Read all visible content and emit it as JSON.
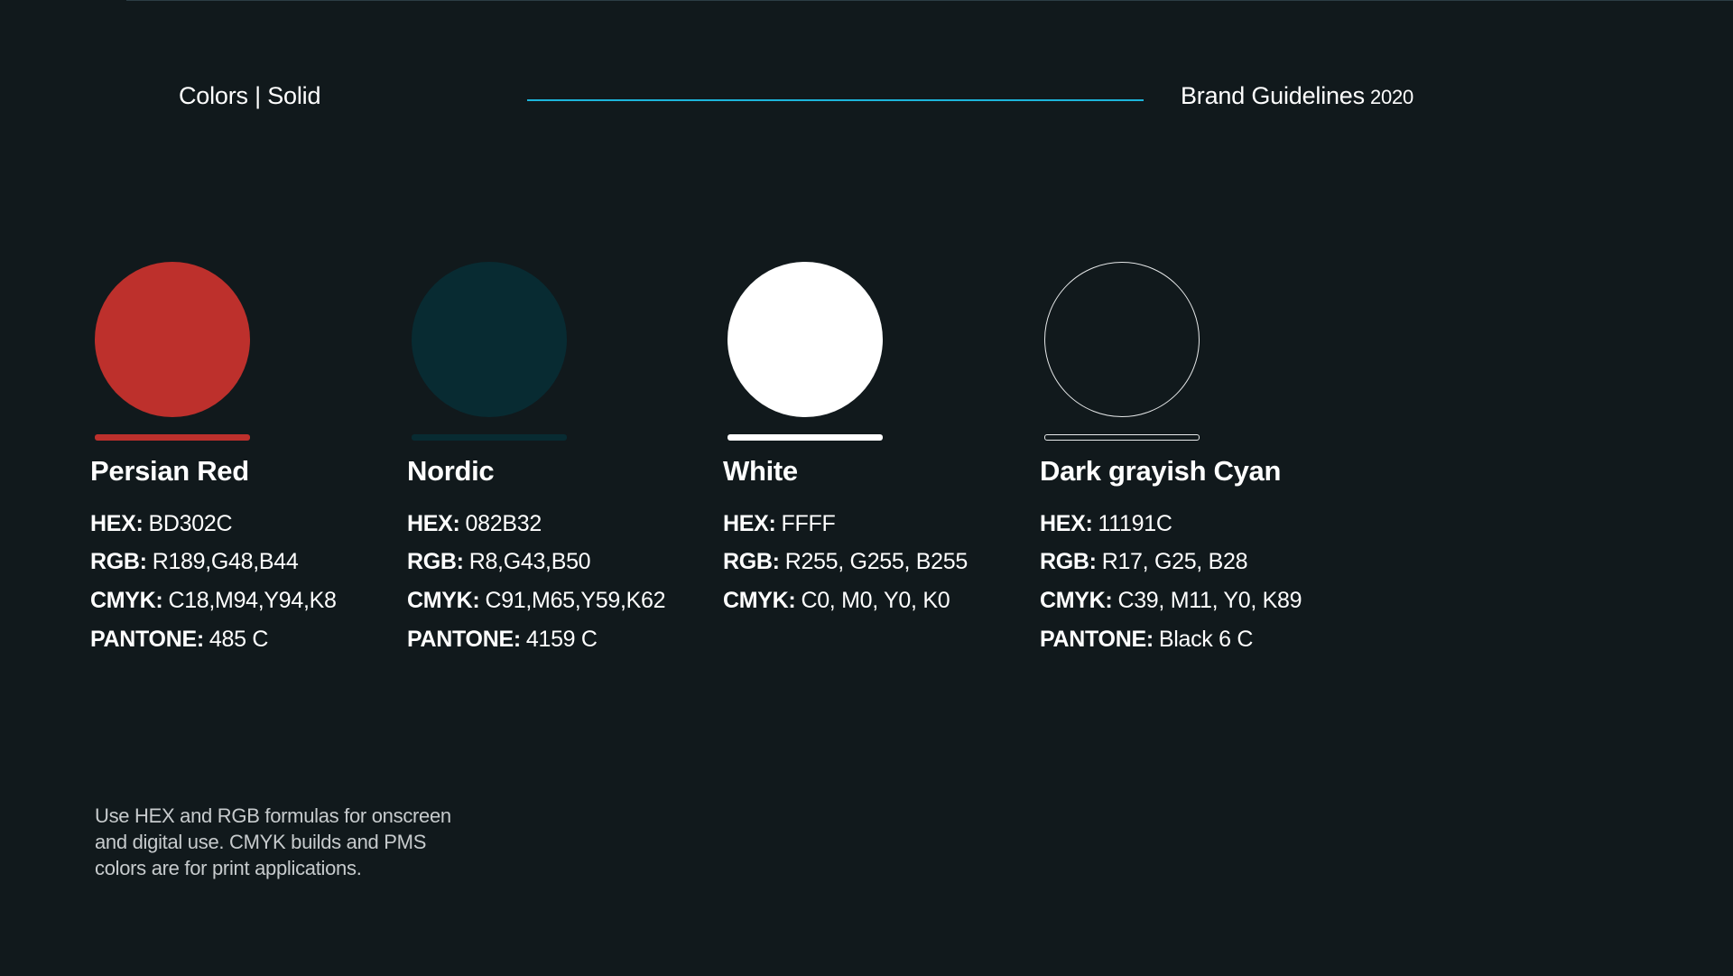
{
  "header": {
    "section_title": "Colors | Solid",
    "brand_title": "Brand Guidelines",
    "brand_year": "2020",
    "rule_color": "#1CB5DA"
  },
  "swatches": [
    {
      "name": "Persian Red",
      "fill": "#BD302C",
      "specs": [
        {
          "label": "HEX:",
          "value": "BD302C"
        },
        {
          "label": "RGB:",
          "value": "R189,G48,B44"
        },
        {
          "label": "CMYK:",
          "value": "C18,M94,Y94,K8"
        },
        {
          "label": "PANTONE:",
          "value": "485 C"
        }
      ]
    },
    {
      "name": "Nordic",
      "fill": "#082B32",
      "specs": [
        {
          "label": "HEX:",
          "value": "082B32"
        },
        {
          "label": "RGB:",
          "value": "R8,G43,B50"
        },
        {
          "label": "CMYK:",
          "value": "C91,M65,Y59,K62"
        },
        {
          "label": "PANTONE:",
          "value": "4159 C"
        }
      ]
    },
    {
      "name": "White",
      "fill": "#FFFFFF",
      "specs": [
        {
          "label": "HEX:",
          "value": "FFFF"
        },
        {
          "label": "RGB:",
          "value": "R255, G255, B255"
        },
        {
          "label": "CMYK:",
          "value": "C0, M0, Y0, K0"
        }
      ]
    },
    {
      "name": "Dark grayish Cyan",
      "fill": "#11191C",
      "specs": [
        {
          "label": "HEX:",
          "value": "11191C"
        },
        {
          "label": "RGB:",
          "value": "R17, G25, B28"
        },
        {
          "label": "CMYK:",
          "value": "C39, M11, Y0, K89"
        },
        {
          "label": "PANTONE:",
          "value": "Black 6 C"
        }
      ]
    }
  ],
  "note": "Use HEX and RGB formulas for onscreen and digital use. CMYK builds and PMS colors are for print applications."
}
